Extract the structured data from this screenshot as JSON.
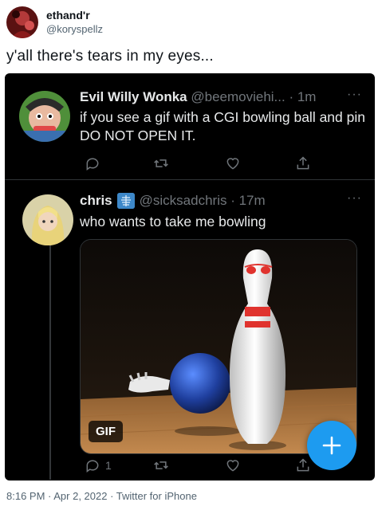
{
  "outer_tweet": {
    "display_name": "ethand'r",
    "handle": "@koryspellz",
    "text": "y'all there's tears in my eyes...",
    "footer": "8:16 PM · Apr 2, 2022 · Twitter for iPhone"
  },
  "screenshot": {
    "tweet1": {
      "display_name": "Evil Willy Wonka",
      "handle_time": "@beemoviehi... · 1m",
      "more": "···",
      "text": "if you see a gif with a CGI bowling ball and pin DO NOT OPEN IT.",
      "actions": {
        "reply_icon": "reply-icon",
        "retweet_icon": "retweet-icon",
        "like_icon": "heart-icon",
        "share_icon": "share-icon"
      }
    },
    "tweet2": {
      "display_name": "chris",
      "badge_icon": "xray-emoji-icon",
      "handle_time": "@sicksadchris · 17m",
      "more": "···",
      "text": "who wants to take me bowling",
      "media_badge": "GIF",
      "reply_count": "1"
    },
    "fab_icon": "plus-icon",
    "colors": {
      "background": "#000000",
      "accent": "#1d9bf0",
      "muted": "#71767b"
    }
  }
}
